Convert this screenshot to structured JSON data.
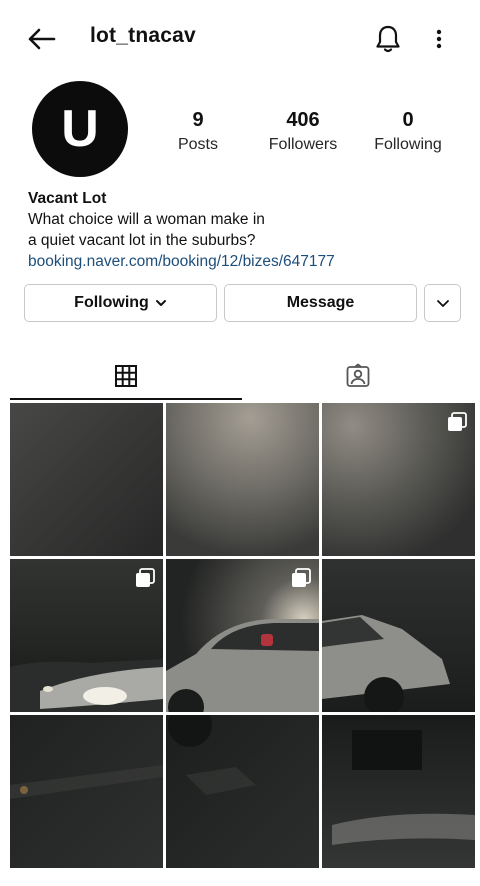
{
  "header": {
    "username": "lot_tnacav",
    "back_icon": "arrow-left-icon",
    "bell_icon": "bell-icon",
    "more_icon": "more-vertical-icon"
  },
  "profile": {
    "avatar_letter": "U",
    "stats": [
      {
        "value": "9",
        "label": "Posts"
      },
      {
        "value": "406",
        "label": "Followers"
      },
      {
        "value": "0",
        "label": "Following"
      }
    ],
    "bio": {
      "name": "Vacant Lot",
      "line1": "What choice will a woman make in",
      "line2": "a quiet vacant lot in the suburbs?",
      "link": "booking.naver.com/booking/12/bizes/647177"
    }
  },
  "actions": {
    "following_label": "Following",
    "message_label": "Message",
    "chevron_icon": "chevron-down-icon"
  },
  "tabs": [
    {
      "name": "posts-grid",
      "icon": "grid-icon",
      "active": true
    },
    {
      "name": "tagged",
      "icon": "tagged-person-icon",
      "active": false
    }
  ],
  "grid": {
    "post_count_shown": 9,
    "multi_photo_posts": [
      3,
      4,
      5
    ]
  }
}
